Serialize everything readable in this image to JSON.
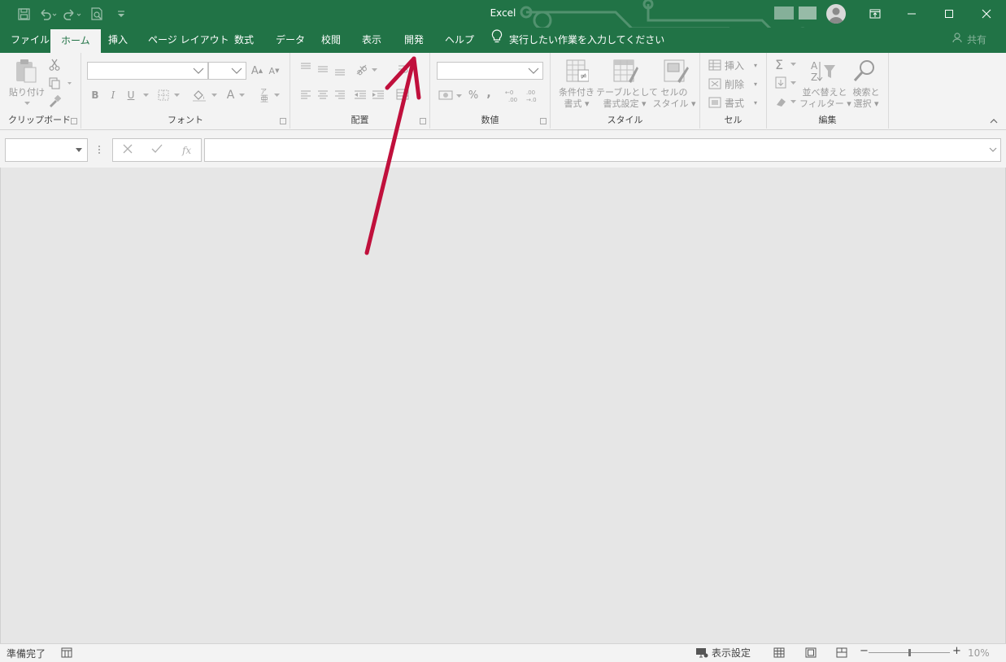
{
  "window": {
    "title": "Excel"
  },
  "tabs": [
    {
      "label": "ファイル"
    },
    {
      "label": "ホーム"
    },
    {
      "label": "挿入"
    },
    {
      "label": "ページ レイアウト"
    },
    {
      "label": "数式"
    },
    {
      "label": "データ"
    },
    {
      "label": "校閲"
    },
    {
      "label": "表示"
    },
    {
      "label": "開発"
    },
    {
      "label": "ヘルプ"
    }
  ],
  "tell_me": {
    "text": "実行したい作業を入力してください",
    "icon": "lightbulb-icon"
  },
  "share": {
    "label": "共有"
  },
  "ribbon": {
    "clipboard": {
      "label": "クリップボード",
      "paste_label": "貼り付け"
    },
    "font": {
      "label": "フォント",
      "bold": "B",
      "italic": "I",
      "underline": "U",
      "grow": "A",
      "shrink": "A",
      "color_a": "A"
    },
    "alignment": {
      "label": "配置"
    },
    "number": {
      "label": "数値",
      "percent": "%",
      "comma": ","
    },
    "styles": {
      "label": "スタイル",
      "conditional_line1": "条件付き",
      "conditional_line2": "書式",
      "table_line1": "テーブルとして",
      "table_line2": "書式設定",
      "cell_style_line1": "セルの",
      "cell_style_line2": "スタイル"
    },
    "cells": {
      "label": "セル",
      "insert": "挿入",
      "delete": "削除",
      "format": "書式"
    },
    "editing": {
      "label": "編集",
      "sort_line1": "並べ替えと",
      "sort_line2": "フィルター",
      "find_line1": "検索と",
      "find_line2": "選択"
    }
  },
  "formula_bar": {
    "fx": "fx"
  },
  "status_bar": {
    "ready": "準備完了",
    "display_settings": "表示設定",
    "zoom_minus": "−",
    "zoom_plus": "+",
    "zoom_level": "10%"
  },
  "colors": {
    "accent": "#217346",
    "arrow": "#c0103c"
  }
}
